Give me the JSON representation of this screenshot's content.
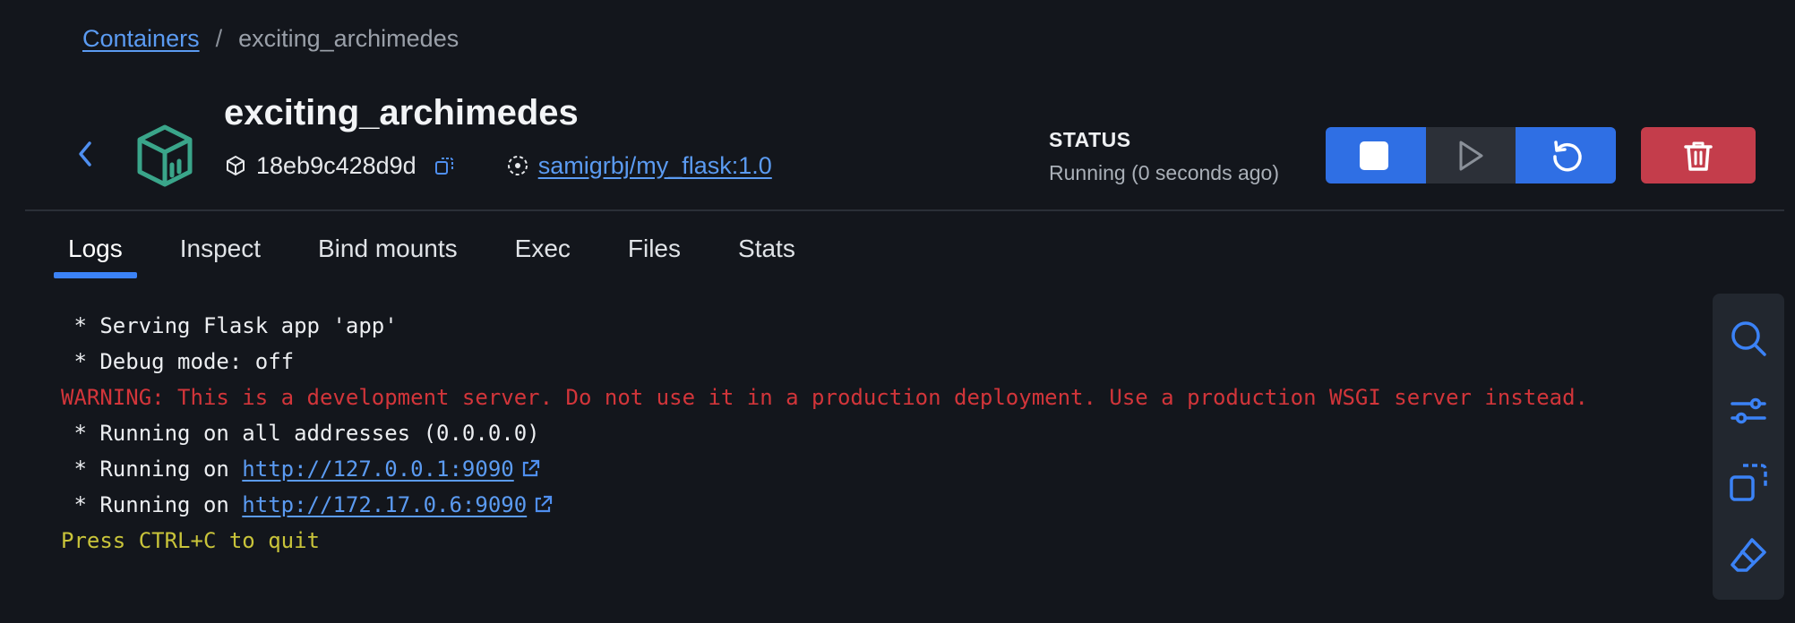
{
  "breadcrumb": {
    "parent": "Containers",
    "separator": "/",
    "current": "exciting_archimedes"
  },
  "container": {
    "name": "exciting_archimedes",
    "id": "18eb9c428d9d",
    "image": "samigrbj/my_flask:1.0",
    "icon": "container-box-icon"
  },
  "status": {
    "label": "STATUS",
    "value": "Running (0 seconds ago)"
  },
  "actions": [
    {
      "name": "stop",
      "icon": "stop-icon"
    },
    {
      "name": "start",
      "icon": "play-icon"
    },
    {
      "name": "restart",
      "icon": "restart-icon"
    },
    {
      "name": "delete",
      "icon": "trash-icon"
    }
  ],
  "tabs": [
    {
      "label": "Logs",
      "active": true
    },
    {
      "label": "Inspect",
      "active": false
    },
    {
      "label": "Bind mounts",
      "active": false
    },
    {
      "label": "Exec",
      "active": false
    },
    {
      "label": "Files",
      "active": false
    },
    {
      "label": "Stats",
      "active": false
    }
  ],
  "logs": {
    "line1": " * Serving Flask app 'app'",
    "line2": " * Debug mode: off",
    "warning": "WARNING: This is a development server. Do not use it in a production deployment. Use a production WSGI server instead.",
    "line4": " * Running on all addresses (0.0.0.0)",
    "running_prefix": " * Running on ",
    "link1": "http://127.0.0.1:9090",
    "link2": "http://172.17.0.6:9090",
    "quit": "Press CTRL+C to quit"
  },
  "toolbar": [
    "search-icon",
    "filter-settings-icon",
    "copy-icon",
    "eraser-icon"
  ],
  "colors": {
    "background": "#13161c",
    "accent": "#2f6fe4",
    "danger": "#c43d4b",
    "warning_text": "#d2353a",
    "quit_text": "#c9c43a",
    "link": "#5b9bf2",
    "container_icon": "#3aa58a"
  }
}
